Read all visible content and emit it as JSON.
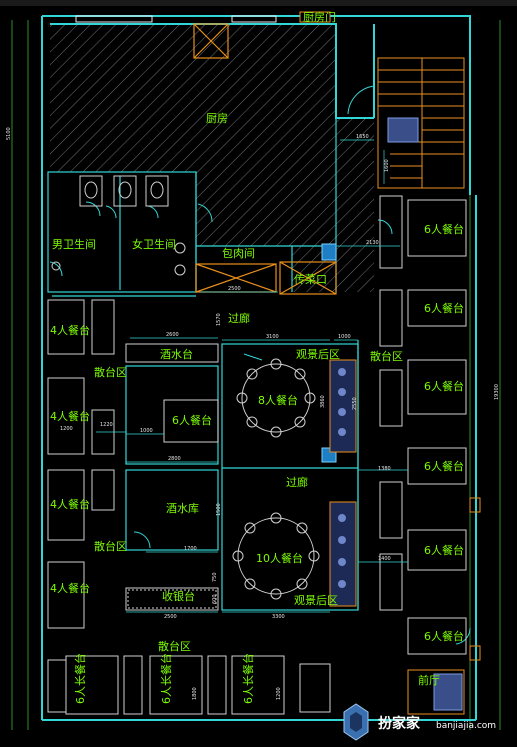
{
  "rooms": {
    "kitchen": "厨房",
    "male_wc": "男卫生间",
    "female_wc": "女卫生间",
    "meat_room": "包肉间",
    "pass_window": "传菜口",
    "corridor_top": "过廊",
    "corridor_mid": "过廊",
    "drink_bar": "酒水台",
    "landscape_1": "观景后区",
    "landscape_2": "观景后区",
    "wine_store": "酒水库",
    "cashier": "收银台",
    "scatter_1": "散台区",
    "scatter_2": "散台区",
    "scatter_3": "散台区",
    "scatter_bottom": "散台区",
    "top_door": "厨房门",
    "bottom_right": "前厅"
  },
  "tables": {
    "t4": "4人餐台",
    "t6": "6人餐台",
    "t6_long": "6人长餐台",
    "t8": "8人餐台",
    "t10": "10人餐台"
  },
  "dimensions": {
    "d1650": "1650",
    "d1600": "1600",
    "d2130": "2130",
    "d2500a": "2500",
    "d1570": "1570",
    "d2600": "2600",
    "d3100": "3100",
    "d1000a": "1000",
    "d1000b": "1000",
    "d1220": "1220",
    "d2800": "2800",
    "d3860": "3860",
    "d2550": "2550",
    "d1200": "1200",
    "d1380": "1380",
    "d1400": "1400",
    "d1700": "1700",
    "d3300": "3300",
    "d2500b": "2500",
    "d1500": "1500",
    "d750": "750",
    "d600": "600",
    "d1800": "1800",
    "d4200": "1200",
    "d19300": "19300",
    "d_left_total": "5100"
  },
  "watermark": {
    "brand": "扮家家",
    "url": "banjiajia.com"
  },
  "colors": {
    "wall": "#33d6d6",
    "label": "#7CFC00",
    "furniture": "#d0d0d0",
    "hatch": "#9aa0a6",
    "accent_orange": "#e8901c",
    "accent_blue": "#4aa3df",
    "background": "#000000"
  }
}
